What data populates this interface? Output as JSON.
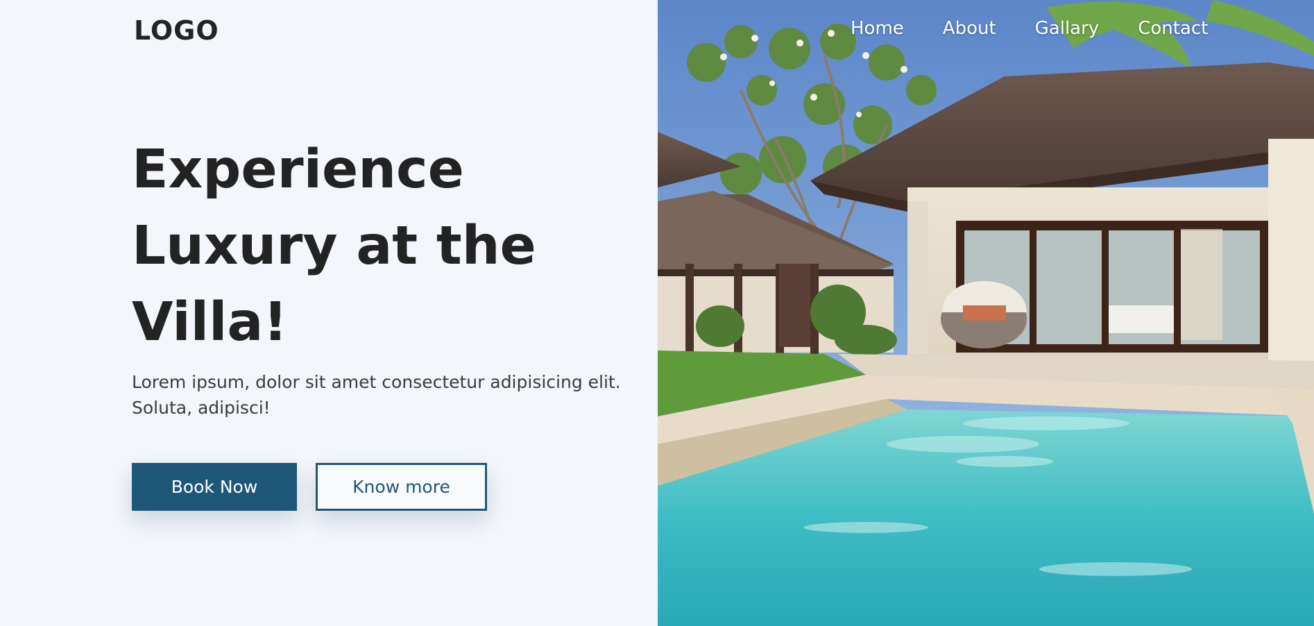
{
  "header": {
    "logo": "LOGO",
    "nav": [
      {
        "label": "Home"
      },
      {
        "label": "About"
      },
      {
        "label": "Gallary"
      },
      {
        "label": "Contact"
      }
    ]
  },
  "hero": {
    "title_line1": "Experience",
    "title_line2": "Luxury at the",
    "title_line3": "Villa!",
    "description_line1": "Lorem ipsum, dolor sit amet consectetur adipisicing elit.",
    "description_line2": "Soluta, adipisci!",
    "primary_button": "Book Now",
    "secondary_button": "Know more",
    "image_subject": "villa-with-swimming-pool"
  },
  "colors": {
    "background": "#f3f6fa",
    "text_dark": "#232323",
    "accent": "#1f5779",
    "nav_text": "#ffffff"
  }
}
